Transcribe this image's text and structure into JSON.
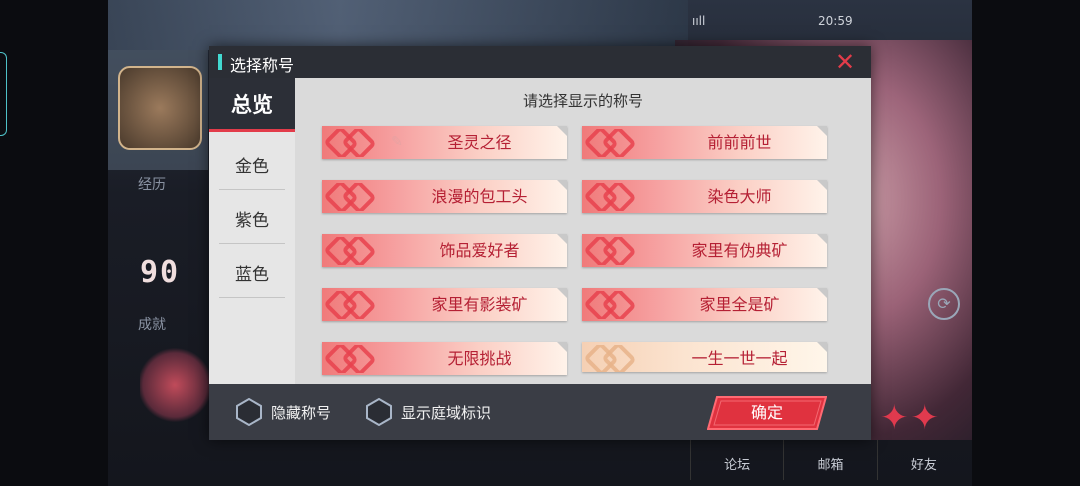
{
  "status_bar": {
    "signal": "ııll",
    "time": "20:59"
  },
  "background": {
    "experience_label": "经历",
    "achievement_label": "成就",
    "stat_value": "90",
    "bottom_nav": [
      "论坛",
      "邮箱",
      "好友"
    ]
  },
  "dialog": {
    "title": "选择称号",
    "prompt": "请选择显示的称号",
    "categories": [
      "总览",
      "金色",
      "紫色",
      "蓝色"
    ],
    "titles": [
      {
        "name": "圣灵之径",
        "style": "red",
        "has_badge": true
      },
      {
        "name": "前前前世",
        "style": "red"
      },
      {
        "name": "浪漫的包工头",
        "style": "red"
      },
      {
        "name": "染色大师",
        "style": "red"
      },
      {
        "name": "饰品爱好者",
        "style": "red"
      },
      {
        "name": "家里有伪典矿",
        "style": "red"
      },
      {
        "name": "家里有影装矿",
        "style": "red"
      },
      {
        "name": "家里全是矿",
        "style": "red"
      },
      {
        "name": "无限挑战",
        "style": "red"
      },
      {
        "name": "一生一世一起",
        "style": "gold"
      }
    ],
    "hide_title_label": "隐藏称号",
    "show_domain_label": "显示庭域标识",
    "confirm_label": "确定"
  },
  "colors": {
    "accent_red": "#e23c4a",
    "title_accent": "#42d9d1",
    "title_text": "#b52034",
    "dark_panel": "#2c2f37"
  }
}
